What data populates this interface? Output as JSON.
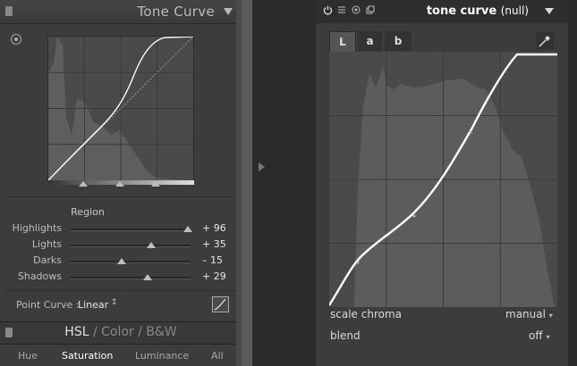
{
  "left_panel": {
    "title": "Tone Curve",
    "region_label": "Region",
    "sliders": [
      {
        "label": "Highlights",
        "value_text": "+ 96",
        "value": 96
      },
      {
        "label": "Lights",
        "value_text": "+ 35",
        "value": 35
      },
      {
        "label": "Darks",
        "value_text": "– 15",
        "value": -15
      },
      {
        "label": "Shadows",
        "value_text": "+ 29",
        "value": 29
      }
    ],
    "slider_range": [
      -100,
      100
    ],
    "point_curve_label": "Point Curve :",
    "point_curve_value": "Linear",
    "point_curve_chevron": "↕",
    "hsl_header": {
      "hsl": "HSL",
      "sep1": " / ",
      "color": "Color",
      "sep2": " / ",
      "bw": "B&W"
    },
    "hsl_tabs": [
      "Hue",
      "Saturation",
      "Luminance",
      "All"
    ],
    "hsl_active_tab": "Saturation"
  },
  "right_panel": {
    "header_icons": [
      "power-icon",
      "presets-icon",
      "reset-icon",
      "multi-instance-icon"
    ],
    "title": "tone curve",
    "title_suffix": "(null)",
    "tabs": [
      "L",
      "a",
      "b"
    ],
    "active_tab": "L",
    "scale_chroma_label": "scale chroma",
    "scale_chroma_value": "manual",
    "blend_label": "blend",
    "blend_value": "off",
    "dropdown_caret": "▾"
  },
  "colors": {
    "panel_bg": "#3c3c3c",
    "curve": "#ffffff",
    "histogram": "#555555"
  }
}
